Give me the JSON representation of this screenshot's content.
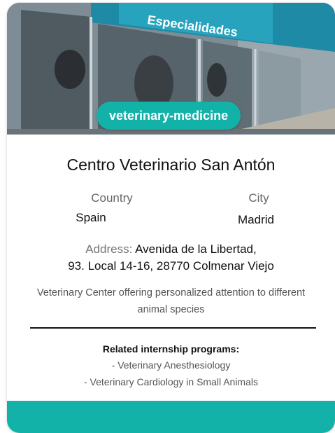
{
  "badge": "veterinary-medicine",
  "photo_sign_text": "Especialidades",
  "center_name": "Centro Veterinario San Antón",
  "country_label": "Country",
  "country_value": "Spain",
  "city_label": "City",
  "city_value": "Madrid",
  "address_label": "Address:",
  "address_line1": "Avenida de la Libertad,",
  "address_line2": "93. Local 14-16, 28770 Colmenar Viejo",
  "description": "Veterinary Center offering personalized attention to different animal species",
  "related_title": "Related internship programs:",
  "related_programs": [
    "- Veterinary Anesthesiology",
    "- Veterinary Cardiology in Small Animals"
  ],
  "colors": {
    "accent": "#13b2a8",
    "text": "#111111",
    "muted": "#666666"
  }
}
